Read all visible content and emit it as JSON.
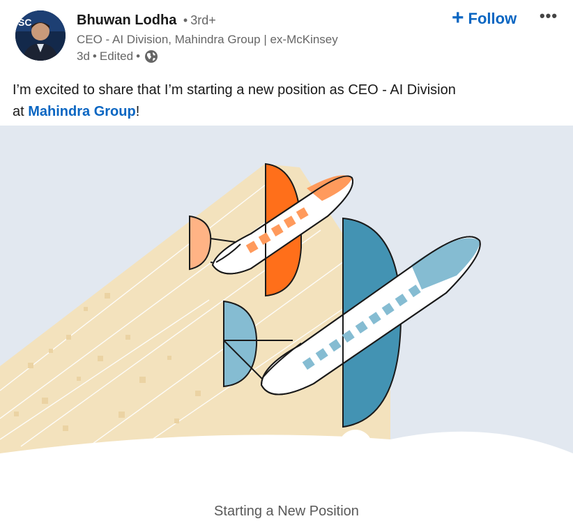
{
  "author": {
    "name": "Bhuwan Lodha",
    "separator": "•",
    "degree": "3rd+",
    "headline": "CEO - AI Division, Mahindra Group | ex-McKinsey",
    "time": "3d",
    "edited": "Edited",
    "visibility_icon": "globe-icon"
  },
  "actions": {
    "follow_icon": "+",
    "follow_label": "Follow",
    "more_label": "•••"
  },
  "post": {
    "text_before": "I’m excited to share that I’m starting a new position as CEO - AI Division",
    "text_at": "at ",
    "company_link": "Mahindra Group",
    "text_after": "!"
  },
  "card": {
    "caption": "Starting a New Position"
  },
  "colors": {
    "link": "#0a66c2",
    "sky": "#e2e8f0",
    "trail": "#f3e2bd",
    "orange": "#ff6f1a",
    "orange_light": "#ff9a5c",
    "peach": "#ffb385",
    "teal_dark": "#4393b3",
    "teal_light": "#85bcd2"
  }
}
